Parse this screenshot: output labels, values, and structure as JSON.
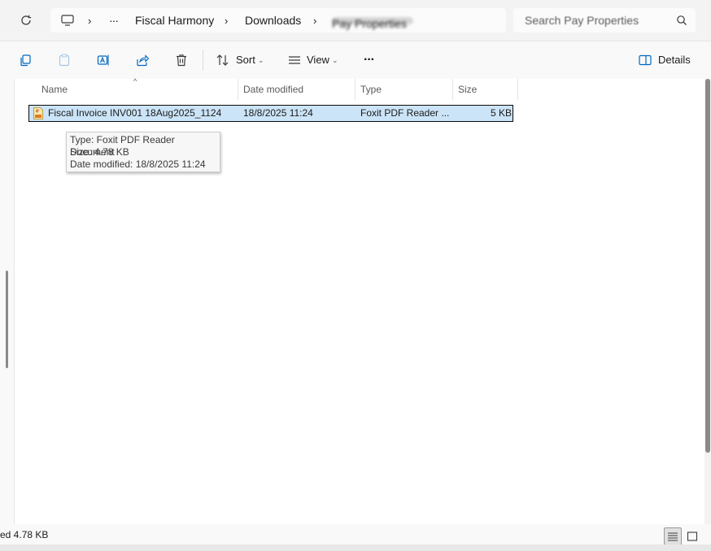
{
  "address": {
    "items": [
      "Fiscal Harmony",
      "Downloads"
    ],
    "blurred_last": "Pay Properties",
    "more": "···"
  },
  "search": {
    "placeholder": "Search Pay Properties"
  },
  "toolbar": {
    "sort_label": "Sort",
    "view_label": "View",
    "more_label": "···",
    "details_label": "Details"
  },
  "columns": {
    "name": "Name",
    "date": "Date modified",
    "type": "Type",
    "size": "Size"
  },
  "files": [
    {
      "name": "Fiscal Invoice INV001 18Aug2025_1124",
      "date": "18/8/2025 11:24",
      "type": "Foxit PDF Reader ...",
      "size": "5 KB"
    }
  ],
  "tooltip": {
    "line1": "Type: Foxit PDF Reader Document",
    "line2": "Size: 4.78 KB",
    "line3": "Date modified: 18/8/2025 11:24"
  },
  "status": {
    "text": "ed  4.78 KB"
  },
  "colors": {
    "selection": "#cce4f7",
    "accent": "#0067c0"
  }
}
